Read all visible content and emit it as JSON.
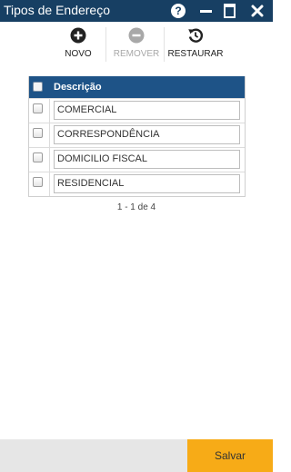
{
  "window": {
    "title": "Tipos de Endereço",
    "help_glyph": "?"
  },
  "toolbar": {
    "new_label": "NOVO",
    "remove_label": "REMOVER",
    "restore_label": "RESTAURAR"
  },
  "grid": {
    "column_header": "Descrição",
    "rows": [
      "COMERCIAL",
      "CORRESPONDÊNCIA",
      "DOMICILIO FISCAL",
      "RESIDENCIAL"
    ]
  },
  "pager": {
    "text": "1 - 1 de 4"
  },
  "footer": {
    "save_label": "Salvar"
  },
  "colors": {
    "titlebar": "#173f63",
    "grid_header": "#1e5387",
    "save_button": "#f7ab17",
    "disabled_text": "#a8a8a8"
  },
  "icons": {
    "new": "plus-circle-icon",
    "remove": "minus-circle-icon",
    "restore": "restore-icon",
    "help": "help-icon",
    "minimize": "minimize-icon",
    "maximize": "maximize-icon",
    "close": "close-icon"
  }
}
